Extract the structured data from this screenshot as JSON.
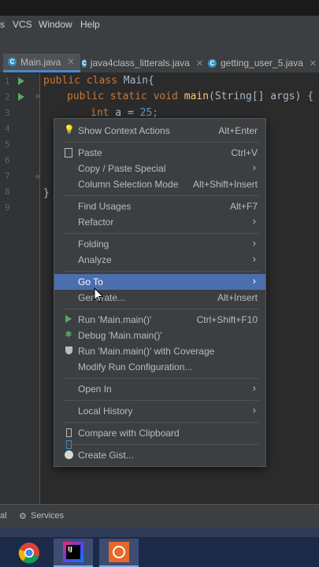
{
  "menubar": {
    "items": [
      "s",
      "VCS",
      "Window",
      "Help"
    ]
  },
  "tabs": [
    {
      "label": "Main.java",
      "active": true
    },
    {
      "label": "java4class_litterals.java",
      "active": false
    },
    {
      "label": "getting_user_5.java",
      "active": false
    }
  ],
  "editor": {
    "line_numbers": [
      "1",
      "2",
      "3",
      "4",
      "5",
      "6",
      "7",
      "8",
      "9"
    ],
    "code": {
      "line1": {
        "kw": "public class",
        "name": " Main{"
      },
      "line2": {
        "kw": "public static void",
        "fn": "main",
        "rest": "(String[] args) {"
      },
      "line3": {
        "kw": "int",
        "rest": " a = ",
        "num": "25",
        "end": ";"
      },
      "line8": "}"
    }
  },
  "context_menu": {
    "items": {
      "show_context_actions": {
        "label": "Show Context Actions",
        "shortcut": "Alt+Enter",
        "icon": "bulb-icon"
      },
      "paste": {
        "label": "Paste",
        "shortcut": "Ctrl+V",
        "icon": "clipboard-icon"
      },
      "copy_paste_special": {
        "label": "Copy / Paste Special"
      },
      "column_selection": {
        "label": "Column Selection Mode",
        "shortcut": "Alt+Shift+Insert"
      },
      "find_usages": {
        "label": "Find Usages",
        "shortcut": "Alt+F7"
      },
      "refactor": {
        "label": "Refactor"
      },
      "folding": {
        "label": "Folding"
      },
      "analyze": {
        "label": "Analyze"
      },
      "go_to": {
        "label": "Go To"
      },
      "generate": {
        "label": "Generate...",
        "shortcut": "Alt+Insert"
      },
      "run": {
        "label": "Run 'Main.main()'",
        "shortcut": "Ctrl+Shift+F10",
        "icon": "run-icon"
      },
      "debug": {
        "label": "Debug 'Main.main()'",
        "icon": "bug-icon"
      },
      "coverage": {
        "label": "Run 'Main.main()' with Coverage",
        "icon": "shield-icon"
      },
      "modify_run": {
        "label": "Modify Run Configuration..."
      },
      "open_in": {
        "label": "Open In"
      },
      "local_history": {
        "label": "Local History"
      },
      "compare_clipboard": {
        "label": "Compare with Clipboard",
        "icon": "compare-icon"
      },
      "create_gist": {
        "label": "Create Gist...",
        "icon": "github-icon"
      }
    }
  },
  "bottombar": {
    "left": "al",
    "services": "Services"
  },
  "taskbar": {
    "intellij_label": "IJ"
  },
  "colors": {
    "accent": "#4b6eaf",
    "background": "#2b2b2b",
    "panel": "#3c3f41"
  }
}
